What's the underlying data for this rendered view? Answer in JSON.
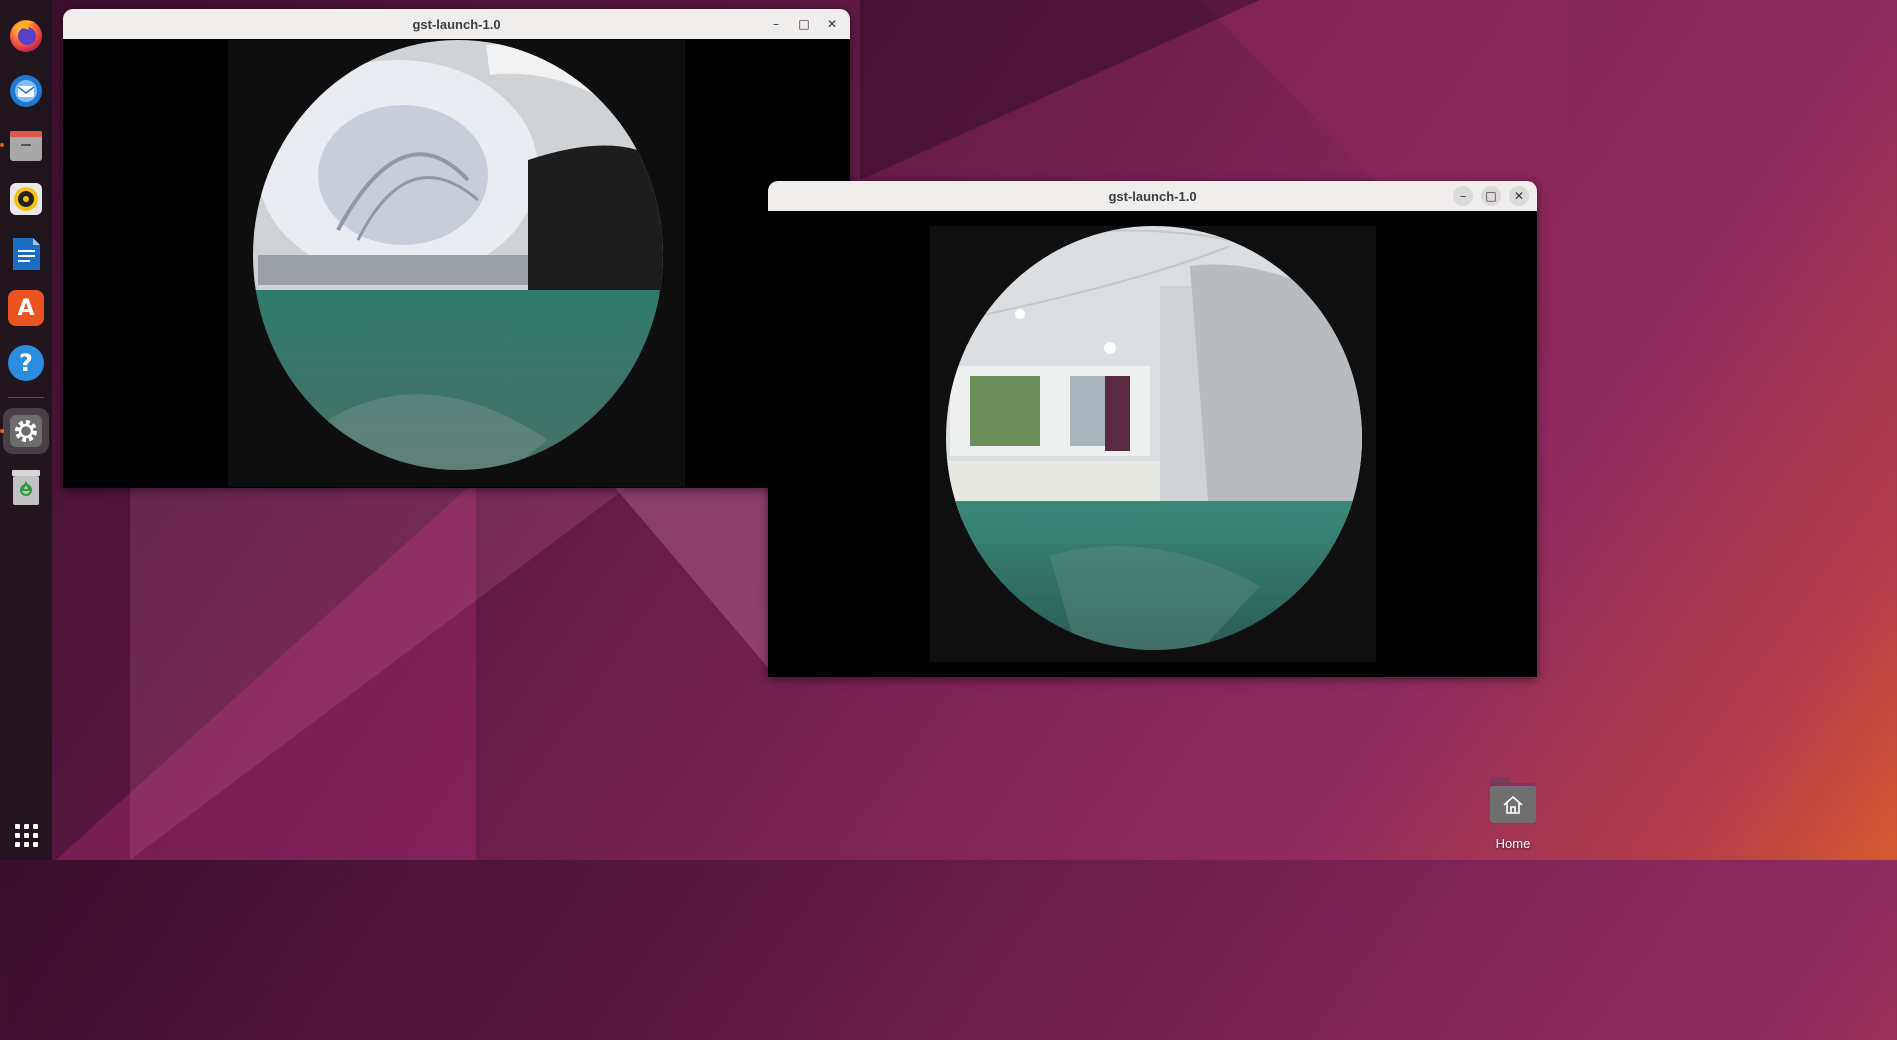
{
  "dock": {
    "items": [
      {
        "name": "firefox",
        "icon": "firefox-icon",
        "color": "#ff7139"
      },
      {
        "name": "thunderbird",
        "icon": "thunderbird-icon",
        "color": "#1f78d1"
      },
      {
        "name": "files",
        "icon": "files-icon",
        "color": "#9a9a9a"
      },
      {
        "name": "rhythmbox",
        "icon": "rhythmbox-icon",
        "color": "#f5c211"
      },
      {
        "name": "libreoffice-writer",
        "icon": "writer-icon",
        "color": "#1a6fc4"
      },
      {
        "name": "app-center",
        "icon": "app-center-icon",
        "color": "#e95420"
      },
      {
        "name": "help",
        "icon": "help-icon",
        "color": "#2a8de0"
      },
      {
        "name": "settings",
        "icon": "gear-icon",
        "color": "#8a8a8a"
      },
      {
        "name": "trash",
        "icon": "trash-icon",
        "color": "#bfbfbf"
      }
    ],
    "help_glyph": "?",
    "appcenter_glyph": "A",
    "show_apps_icon": "grid-icon"
  },
  "windows": [
    {
      "title": "gst-launch-1.0",
      "minimize": "–",
      "maximize": "□",
      "close": "✕"
    },
    {
      "title": "gst-launch-1.0",
      "minimize": "–",
      "maximize": "□",
      "close": "✕"
    }
  ],
  "desktop": {
    "home_label": "Home"
  },
  "colors": {
    "accent": "#e95420",
    "floor_green": "#2f7b6b"
  }
}
